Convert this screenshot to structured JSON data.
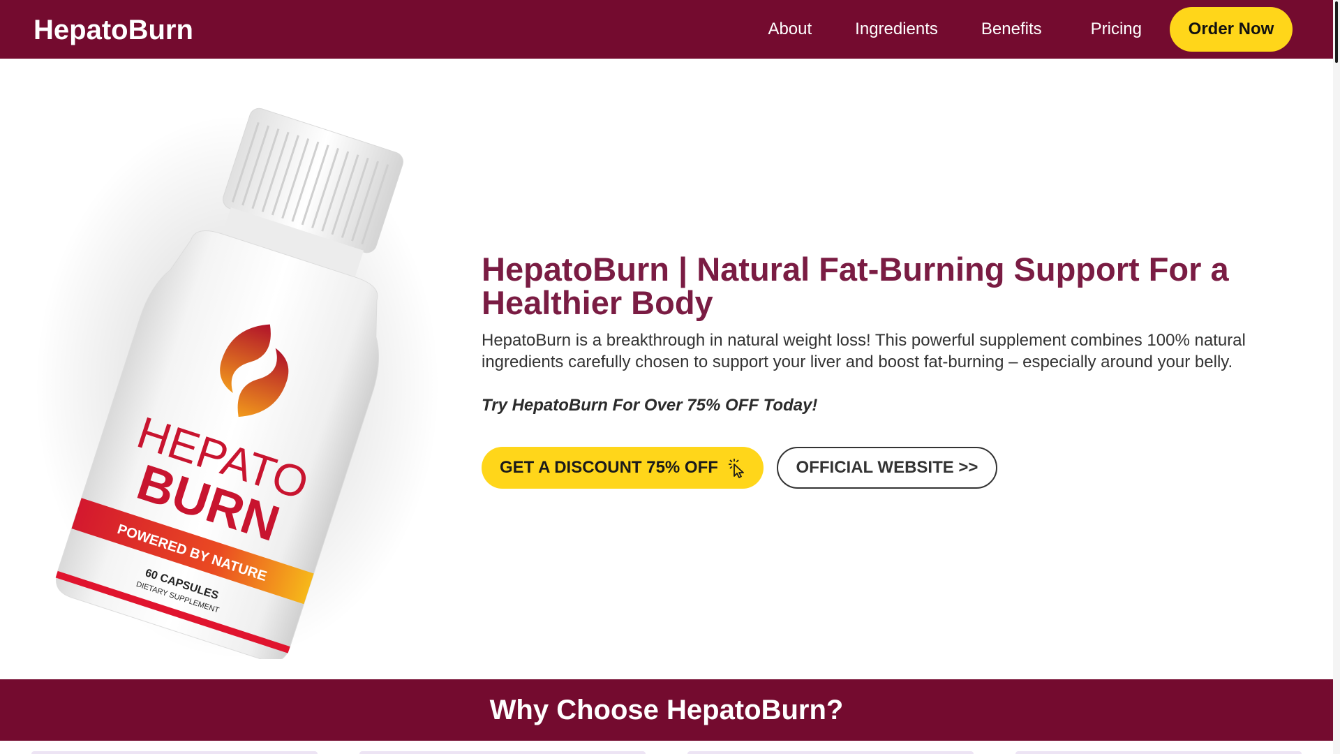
{
  "header": {
    "logo": "HepatoBurn",
    "nav": {
      "about": "About",
      "ingredients": "Ingredients",
      "benefits": "Benefits",
      "pricing": "Pricing"
    },
    "order_label": "Order Now"
  },
  "hero": {
    "title": "HepatoBurn | Natural Fat-Burning Support For a Healthier Body",
    "description": "HepatoBurn is a breakthrough in natural weight loss! This powerful supplement combines 100% natural ingredients carefully chosen to support your liver and boost fat-burning – especially around your belly.",
    "cta_text": "Try HepatoBurn For Over 75% OFF Today!",
    "discount_button": "GET A DISCOUNT 75% OFF",
    "official_button": "OFFICIAL WEBSITE >>",
    "bottle": {
      "brand_line1": "HEPATO",
      "brand_line2": "BURN",
      "tagline": "POWERED BY NATURE",
      "capsules": "60 CAPSULES",
      "supplement": "DIETARY SUPPLEMENT"
    }
  },
  "why_section": {
    "title": "Why Choose HepatoBurn?"
  },
  "colors": {
    "brand": "#740b2f",
    "title_text": "#7a1c43",
    "accent_yellow": "#ffd61a"
  }
}
